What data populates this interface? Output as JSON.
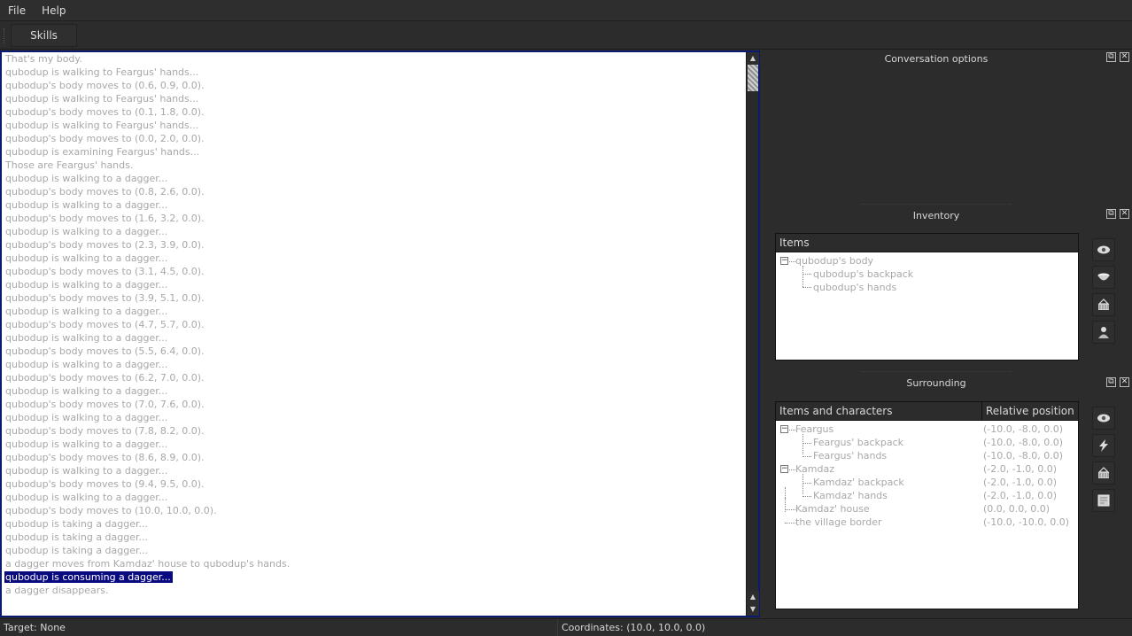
{
  "menu": {
    "file": "File",
    "help": "Help"
  },
  "toolbar": {
    "skills": "Skills"
  },
  "log": {
    "lines": [
      "That's my body.",
      "qubodup is walking to Feargus' hands...",
      "qubodup's body moves to (0.6, 0.9, 0.0).",
      "qubodup is walking to Feargus' hands...",
      "qubodup's body moves to (0.1, 1.8, 0.0).",
      "qubodup is walking to Feargus' hands...",
      "qubodup's body moves to (0.0, 2.0, 0.0).",
      "qubodup is examining Feargus' hands...",
      "Those are Feargus' hands.",
      "qubodup is walking to a dagger...",
      "qubodup's body moves to (0.8, 2.6, 0.0).",
      "qubodup is walking to a dagger...",
      "qubodup's body moves to (1.6, 3.2, 0.0).",
      "qubodup is walking to a dagger...",
      "qubodup's body moves to (2.3, 3.9, 0.0).",
      "qubodup is walking to a dagger...",
      "qubodup's body moves to (3.1, 4.5, 0.0).",
      "qubodup is walking to a dagger...",
      "qubodup's body moves to (3.9, 5.1, 0.0).",
      "qubodup is walking to a dagger...",
      "qubodup's body moves to (4.7, 5.7, 0.0).",
      "qubodup is walking to a dagger...",
      "qubodup's body moves to (5.5, 6.4, 0.0).",
      "qubodup is walking to a dagger...",
      "qubodup's body moves to (6.2, 7.0, 0.0).",
      "qubodup is walking to a dagger...",
      "qubodup's body moves to (7.0, 7.6, 0.0).",
      "qubodup is walking to a dagger...",
      "qubodup's body moves to (7.8, 8.2, 0.0).",
      "qubodup is walking to a dagger...",
      "qubodup's body moves to (8.6, 8.9, 0.0).",
      "qubodup is walking to a dagger...",
      "qubodup's body moves to (9.4, 9.5, 0.0).",
      "qubodup is walking to a dagger...",
      "qubodup's body moves to (10.0, 10.0, 0.0).",
      "qubodup is taking a dagger...",
      "qubodup is taking a dagger...",
      "qubodup is taking a dagger...",
      "a dagger moves from Kamdaz' house to qubodup's hands.",
      "qubodup is consuming a dagger...",
      "a dagger disappears."
    ],
    "selected_index": 39
  },
  "conversation": {
    "title": "Conversation options"
  },
  "inventory": {
    "title": "Inventory",
    "header": "Items",
    "root": "qubodup's body",
    "children": [
      "qubodup's backpack",
      "qubodup's hands"
    ],
    "buttons": [
      "eye-icon",
      "bowl-icon",
      "basket-icon",
      "person-icon"
    ]
  },
  "surrounding": {
    "title": "Surrounding",
    "header_items": "Items and characters",
    "header_position": "Relative position",
    "rows": [
      {
        "name": "Feargus",
        "position": "(-10.0, -8.0, 0.0)"
      },
      {
        "name": "Feargus' backpack",
        "position": "(-10.0, -8.0, 0.0)"
      },
      {
        "name": "Feargus' hands",
        "position": "(-10.0, -8.0, 0.0)"
      },
      {
        "name": "Kamdaz",
        "position": "(-2.0, -1.0, 0.0)"
      },
      {
        "name": "Kamdaz' backpack",
        "position": "(-2.0, -1.0, 0.0)"
      },
      {
        "name": "Kamdaz' hands",
        "position": "(-2.0, -1.0, 0.0)"
      },
      {
        "name": "Kamdaz' house",
        "position": "(0.0, 0.0, 0.0)"
      },
      {
        "name": "the village border",
        "position": "(-10.0, -10.0, 0.0)"
      }
    ],
    "buttons": [
      "eye-icon",
      "lightning-icon",
      "basket-icon",
      "map-icon"
    ]
  },
  "status": {
    "target": "Target: None",
    "coordinates": "Coordinates: (10.0, 10.0, 0.0)"
  }
}
